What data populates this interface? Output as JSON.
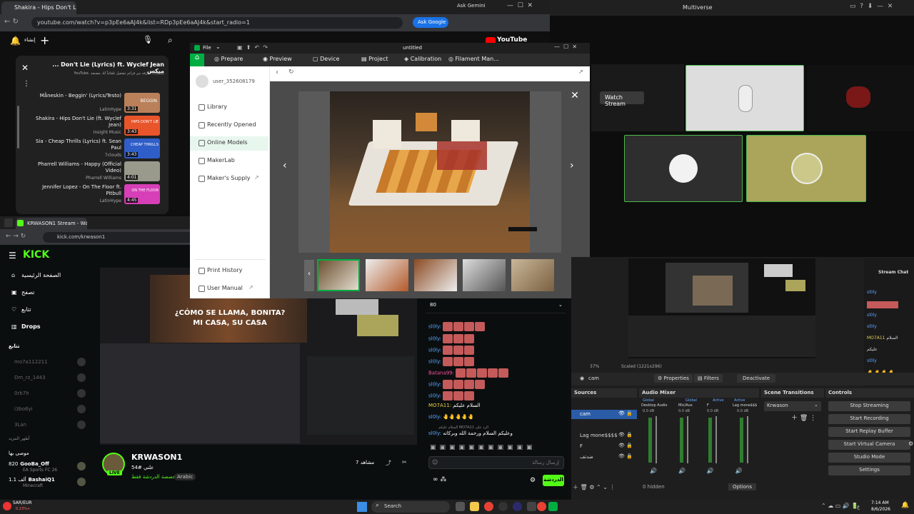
{
  "youtube": {
    "tab_title": "Shakira - Hips Don't Lie (Lyr",
    "url": "youtube.com/watch?v=p3pEe6aAJ4k&list=RDp3pEe6aAJ4k&start_radio=1",
    "ask_gemini": "Ask Gemini",
    "ask_google": "Ask Google",
    "logo": "YouTube",
    "logo_cc": "SK",
    "playlist_header": "... Don't Lie (Lyrics) ft. Wyclef Jean ميكس",
    "playlist_sub": "YouTube. ميكسات عازفة من قرائم تشغيل تلقائياً لك مصنفة",
    "items": [
      {
        "title": "Måneskin - Beggin' (Lyrics/Testo)",
        "channel": "LatinHype",
        "duration": "3:31",
        "color": "#b9805a",
        "thumb_text": "BEGGIN"
      },
      {
        "title": "Shakira - Hips Don't Lie (ft. Wyclef Jean)",
        "channel": "Insight Music",
        "duration": "3:43",
        "color": "#e8552b",
        "thumb_text": "HIPS DON'T LIE"
      },
      {
        "title": "Sia - Cheap Thrills (Lyrics) ft. Sean Paul",
        "channel": "7clouds",
        "duration": "3:43",
        "color": "#2f5ec8",
        "thumb_text": "CHEAP THRILLS"
      },
      {
        "title": "Pharrell Williams - Happy (Official Video)",
        "channel": "Pharrell Williams",
        "duration": "4:01",
        "color": "#9a9a8c",
        "thumb_text": ""
      },
      {
        "title": "Jennifer Lopez - On The Floor ft. Pitbull",
        "channel": "LatinHype",
        "duration": "4:45",
        "color": "#d63fb7",
        "thumb_text": "ON THE FLOOR"
      }
    ]
  },
  "multiverse": {
    "title": "Multiverse",
    "watch_stream": "Watch Stream"
  },
  "kick": {
    "tab_title": "KRWASON1 Stream - Watch Li",
    "url": "kick.com/krwason1",
    "logo": "KICK",
    "nav": [
      "الصفحة الرئيسية",
      "تصفح",
      "تتابع",
      "Drops"
    ],
    "following_header": "تتابع",
    "following": [
      "mo7a112211",
      "Dm_rz_1443",
      "0rb7h",
      "i3bo6yi",
      "3Lan"
    ],
    "show_more": "أظهر المزيد",
    "recommended": "موصى بها",
    "rec": [
      {
        "count": "820",
        "name": "GooBa_Off",
        "game": "EA Sports FC 26"
      },
      {
        "count": "1.1 ألف",
        "name": "BashaiQ1",
        "game": "Minecraft"
      }
    ],
    "stream_caption_1": "¿CÓMO SE LLAMA, BONITA?",
    "stream_caption_2": "MI CASA, SU CASA",
    "live_badge": "LIVE",
    "streamer": "KRWASON1",
    "stream_title": "54# علني",
    "stream_category": "مخصصة الدردشة فقط",
    "language": "Arabic",
    "viewers": "7 مشاهد",
    "chat_pinned_count": "80",
    "chat": [
      {
        "user": "sl0ly:",
        "msg": "",
        "emotes": 4
      },
      {
        "user": "sl0ly:",
        "msg": "",
        "emotes": 4
      },
      {
        "user": "sl0ly:",
        "msg": "",
        "emotes": 4
      },
      {
        "user": "sl0ly:",
        "msg": "",
        "emotes": 4
      },
      {
        "user": "Batana99:",
        "msg": "",
        "emotes": 6
      },
      {
        "user": "sl0ly:",
        "msg": "",
        "emotes": 4
      },
      {
        "user": "sl0ly:",
        "msg": "",
        "emotes": 4
      },
      {
        "user": "MO7A11:",
        "msg": "السلام عليكم",
        "emotes": 0
      },
      {
        "user": "sl0ly:",
        "msg": "",
        "emotes": 5
      },
      {
        "user": "sl0ly:",
        "msg": "وعليكم السلام ورحمة الله وبركاته",
        "emotes": 0
      }
    ],
    "chat_reply_note": "السلام عليكم MO7A11 الرد على",
    "chat_placeholder": "إرسال رسالة",
    "chat_send": "الدردشة"
  },
  "bambu": {
    "menu_file": "File",
    "doc_title": "untitled",
    "tabs": [
      "Prepare",
      "Preview",
      "Device",
      "Project",
      "Calibration",
      "Filament Man..."
    ],
    "user": "user_352608179",
    "side_items": [
      "Library",
      "Recently Opened",
      "Online Models",
      "MakerLab",
      "Maker's Supply"
    ],
    "active_item": "Online Models",
    "bottom_items": [
      "Print History",
      "User Manual"
    ],
    "thumb_count": 5
  },
  "obs": {
    "source_name": "cam",
    "properties": "Properties",
    "filters": "Filters",
    "deactivate": "Deactivate",
    "docks": [
      "Sources",
      "Audio Mixer",
      "Scene Transitions",
      "Controls"
    ],
    "sources": [
      "cam",
      "Lag mone$$$$",
      "F",
      "ضدتف"
    ],
    "mixer_channels": [
      "Desktop Audio",
      "Mic/Aux",
      "F",
      "Lag mone$$$"
    ],
    "mixer_top": [
      "Global",
      "Global",
      "Active",
      "Active"
    ],
    "db_values": [
      "0.0 dB",
      "0.0 dB",
      "0.0 dB",
      "0.0 dB"
    ],
    "transition": "Krwason",
    "controls": [
      "Stop Streaming",
      "Start Recording",
      "Start Replay Buffer",
      "Start Virtual Camera",
      "Studio Mode",
      "Settings"
    ],
    "hidden": "0 hidden",
    "options": "Options",
    "stream_chat": "Stream Chat",
    "stream_chat_users": [
      "sl0ly",
      "sl0ly",
      "sl0ly",
      "MO7A11",
      "sl0ly"
    ],
    "stream_chat_msgs": [
      "",
      "",
      "",
      "السلام",
      "عليكم"
    ],
    "zoom": "37%",
    "scale": "Scaled (1221x296)"
  },
  "taskbar": {
    "currency": "SAR/EUR",
    "change": "0.23%+",
    "search": "Search",
    "time": "7:14 AM",
    "date": "8/6/2026",
    "lang": "ع"
  }
}
